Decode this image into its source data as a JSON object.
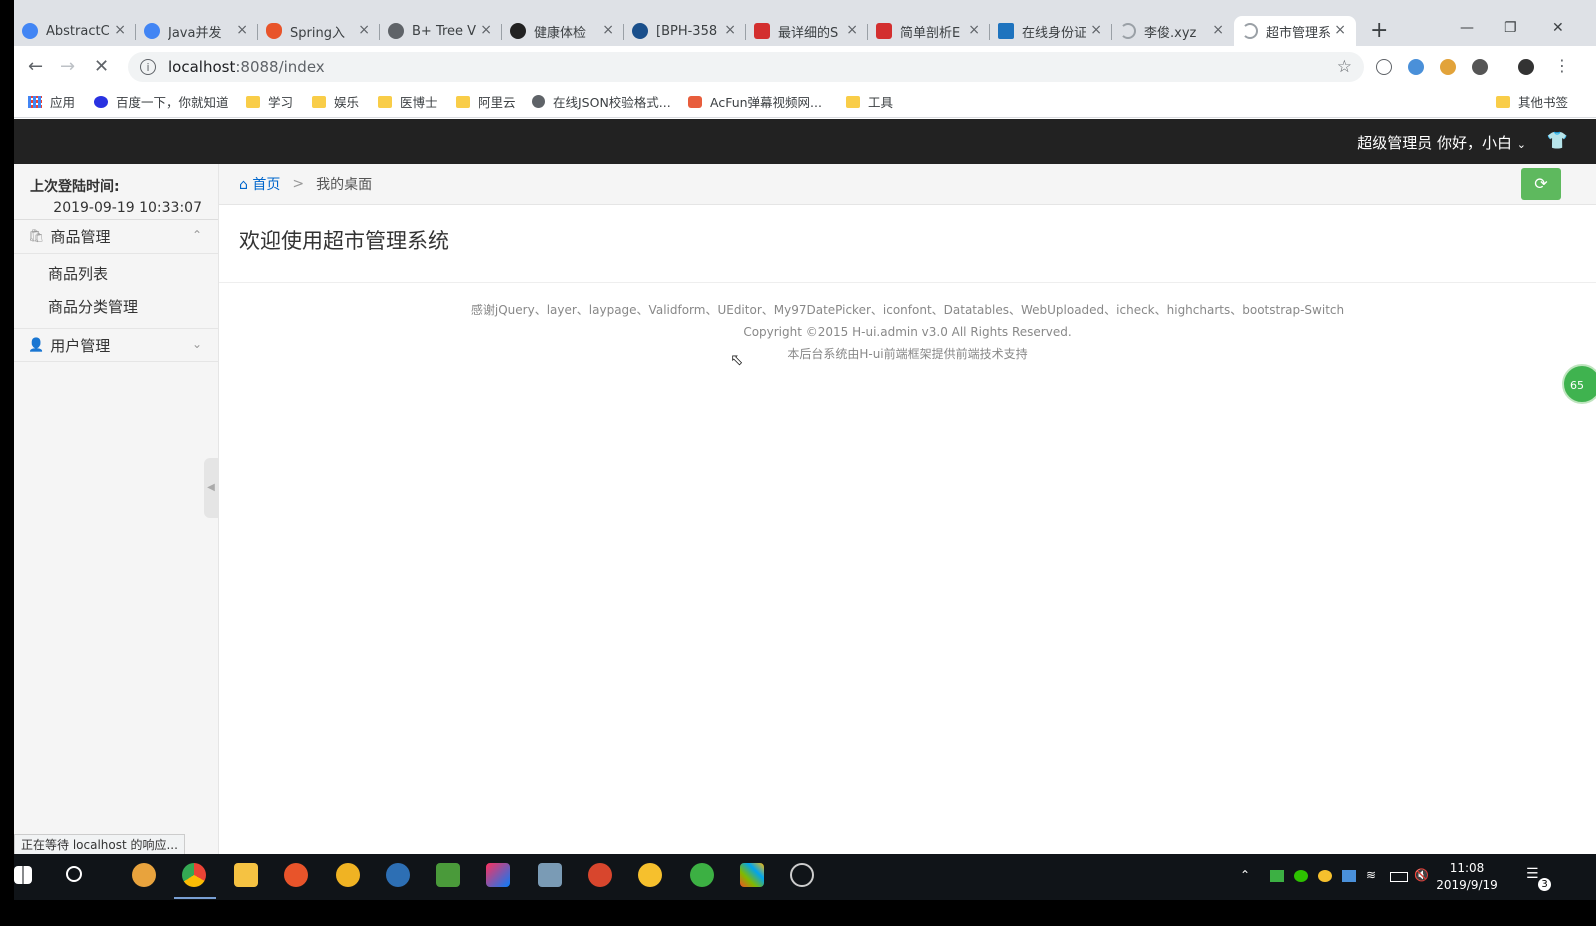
{
  "browser": {
    "tabs": [
      {
        "label": "AbstractC",
        "color": "#4285f4"
      },
      {
        "label": "Java并发",
        "color": "#4285f4"
      },
      {
        "label": "Spring入",
        "color": "#e8542a"
      },
      {
        "label": "B+ Tree V",
        "color": "#5f6368"
      },
      {
        "label": "健康体检",
        "color": "#222"
      },
      {
        "label": "[BPH-358",
        "color": "#1a4f8b"
      },
      {
        "label": "最详细的S",
        "color": "#d32f2f"
      },
      {
        "label": "简单剖析E",
        "color": "#d32f2f"
      },
      {
        "label": "在线身份证",
        "color": "#1e73be"
      },
      {
        "label": "李俊.xyz",
        "color": "#9aa0a6"
      },
      {
        "label": "超市管理系",
        "color": "#9aa0a6"
      }
    ],
    "close_glyph": "×",
    "new_tab": "+",
    "url_host": "localhost",
    "url_path": ":8088/index",
    "bookmarks": [
      {
        "label": "应用",
        "type": "apps"
      },
      {
        "label": "百度一下，你就知道",
        "type": "baidu"
      },
      {
        "label": "学习",
        "type": "folder"
      },
      {
        "label": "娱乐",
        "type": "folder"
      },
      {
        "label": "医博士",
        "type": "folder"
      },
      {
        "label": "阿里云",
        "type": "folder"
      },
      {
        "label": "在线JSON校验格式...",
        "type": "globe"
      },
      {
        "label": "AcFun弹幕视频网...",
        "type": "acfun"
      },
      {
        "label": "工具",
        "type": "folder"
      }
    ],
    "other_bookmarks": "其他书签",
    "status_text": "正在等待 localhost 的响应..."
  },
  "app": {
    "header_user": "超级管理员  你好，小白",
    "last_login_label": "上次登陆时间:",
    "last_login_value": "2019-09-19 10:33:07",
    "menu": [
      {
        "label": "商品管理",
        "icon": "bag-icon",
        "expanded": true,
        "items": [
          "商品列表",
          "商品分类管理"
        ]
      },
      {
        "label": "用户管理",
        "icon": "user-icon",
        "expanded": false,
        "items": []
      }
    ],
    "breadcrumb_home": "首页",
    "breadcrumb_sep": ">",
    "breadcrumb_current": "我的桌面",
    "welcome": "欢迎使用超市管理系统",
    "footer_thanks": "感谢jQuery、layer、laypage、Validform、UEditor、My97DatePicker、iconfont、Datatables、WebUploaded、icheck、highcharts、bootstrap-Switch",
    "footer_copyright": "Copyright ©2015 H-ui.admin v3.0 All Rights Reserved.",
    "footer_support": "本后台系统由H-ui前端框架提供前端技术支持",
    "float_badge": "65"
  },
  "taskbar": {
    "time": "11:08",
    "date": "2019/9/19",
    "notifications": "3"
  }
}
